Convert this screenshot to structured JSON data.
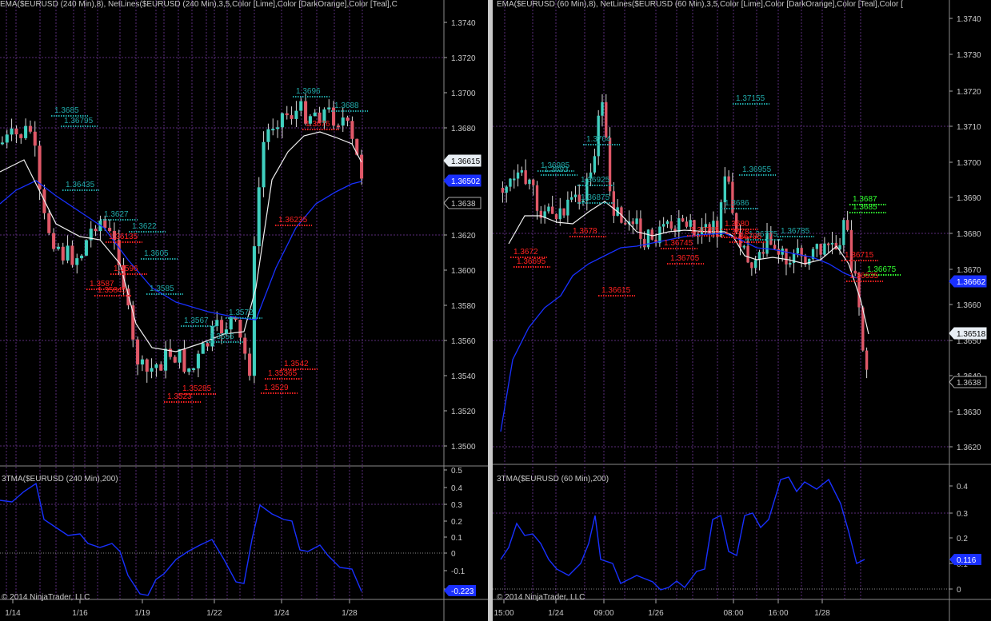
{
  "colors": {
    "background": "#000000",
    "grid": "#5a2d7a",
    "axis": "#9a9a9a",
    "up_candle": "#40d0c0",
    "down_candle": "#e05868",
    "ema": "#f0f0f0",
    "tma": "#1830ff",
    "netline_teal": "#20a8a8",
    "netline_red": "#ff2020",
    "netline_lime": "#30ff30"
  },
  "charts": [
    {
      "id": "left",
      "title": "EMA($EURUSD (240 Min),8), NetLines($EURUSD (240 Min),3,5,Color [Lime],Color [DarkOrange],Color [Teal],C",
      "indicator_title": "3TMA($EURUSD (240 Min),200)",
      "copyright": "© 2014 NinjaTrader, LLC",
      "price_ticks": [
        "1.3740",
        "1.3720",
        "1.3700",
        "1.3680",
        "1.3620",
        "1.3600",
        "1.3580",
        "1.3560",
        "1.3540",
        "1.3520",
        "1.3500"
      ],
      "indicator_ticks": [
        "0.5",
        "0.4",
        "0.3",
        "0.2",
        "0.1",
        "0",
        "-0.1",
        "-0.2"
      ],
      "x_labels": [
        "1/14",
        "1/16",
        "1/19",
        "1/22",
        "1/24",
        "1/28"
      ],
      "price_badges": [
        {
          "text": "1.36615",
          "style": "light"
        },
        {
          "text": "1.36502",
          "style": "blue"
        },
        {
          "text": "1.3638",
          "style": "dark"
        }
      ],
      "indicator_badge": "-0.223",
      "labels": [
        {
          "text": "1.3685",
          "c": "teal"
        },
        {
          "text": "1.36795",
          "c": "teal"
        },
        {
          "text": "1.36435",
          "c": "teal"
        },
        {
          "text": "1.3627",
          "c": "teal"
        },
        {
          "text": "1.3622",
          "c": "teal"
        },
        {
          "text": "1.3605",
          "c": "teal"
        },
        {
          "text": "1.3585",
          "c": "teal"
        },
        {
          "text": "1.3567",
          "c": "teal"
        },
        {
          "text": "1.3572",
          "c": "teal"
        },
        {
          "text": "1.3556",
          "c": "teal"
        },
        {
          "text": "1.3696",
          "c": "teal"
        },
        {
          "text": "1.3688",
          "c": "teal"
        },
        {
          "text": "1.3676",
          "c": "red"
        },
        {
          "text": "1.36235",
          "c": "red"
        },
        {
          "text": "1.36135",
          "c": "red"
        },
        {
          "text": "1.3596",
          "c": "red"
        },
        {
          "text": "1.3587",
          "c": "red"
        },
        {
          "text": "1.35845",
          "c": "red"
        },
        {
          "text": "1.3542",
          "c": "red"
        },
        {
          "text": "1.35365",
          "c": "red"
        },
        {
          "text": "1.3529",
          "c": "red"
        },
        {
          "text": "1.35285",
          "c": "red"
        },
        {
          "text": "1.3523",
          "c": "red"
        }
      ]
    },
    {
      "id": "right",
      "title": "EMA($EURUSD (60 Min),8), NetLines($EURUSD (60 Min),3,5,Color [Lime],Color [DarkOrange],Color [Teal],Color [",
      "indicator_title": "3TMA($EURUSD (60 Min),200)",
      "copyright": "© 2014 NinjaTrader, LLC",
      "price_ticks": [
        "1.3740",
        "1.3730",
        "1.3720",
        "1.3710",
        "1.3700",
        "1.3690",
        "1.3680",
        "1.3670",
        "1.3660",
        "1.3650",
        "1.3640",
        "1.3630",
        "1.3620"
      ],
      "indicator_ticks": [
        "0.4",
        "0.3",
        "0.2",
        "0.1",
        "0"
      ],
      "x_labels": [
        "15:00",
        "1/24",
        "09:00",
        "1/26",
        "08:00",
        "16:00",
        "1/28"
      ],
      "price_badges": [
        {
          "text": "1.36662",
          "style": "blue"
        },
        {
          "text": "1.36518",
          "style": "light"
        },
        {
          "text": "1.3638",
          "style": "dark"
        }
      ],
      "indicator_badge": "0.116",
      "labels": [
        {
          "text": "1.37155",
          "c": "teal"
        },
        {
          "text": "1.3704",
          "c": "teal"
        },
        {
          "text": "1.36985",
          "c": "teal"
        },
        {
          "text": "1.36955",
          "c": "teal"
        },
        {
          "text": "1.3693",
          "c": "teal"
        },
        {
          "text": "1.36925",
          "c": "teal"
        },
        {
          "text": "1.36875",
          "c": "teal"
        },
        {
          "text": "1.3686",
          "c": "teal"
        },
        {
          "text": "1.36775",
          "c": "teal"
        },
        {
          "text": "1.36785",
          "c": "teal"
        },
        {
          "text": "1.3687",
          "c": "lime"
        },
        {
          "text": "1.3685",
          "c": "lime"
        },
        {
          "text": "1.36675",
          "c": "lime"
        },
        {
          "text": "1.3672",
          "c": "red"
        },
        {
          "text": "1.36695",
          "c": "red"
        },
        {
          "text": "1.3678",
          "c": "red"
        },
        {
          "text": "1.36745",
          "c": "red"
        },
        {
          "text": "1.36705",
          "c": "red"
        },
        {
          "text": "1.36615",
          "c": "red"
        },
        {
          "text": "1.36785",
          "c": "red"
        },
        {
          "text": "1.3680",
          "c": "red"
        },
        {
          "text": "1.3678",
          "c": "red"
        },
        {
          "text": "1.36785",
          "c": "red"
        },
        {
          "text": "1.36715",
          "c": "red"
        },
        {
          "text": "1.36635",
          "c": "red"
        }
      ]
    }
  ]
}
